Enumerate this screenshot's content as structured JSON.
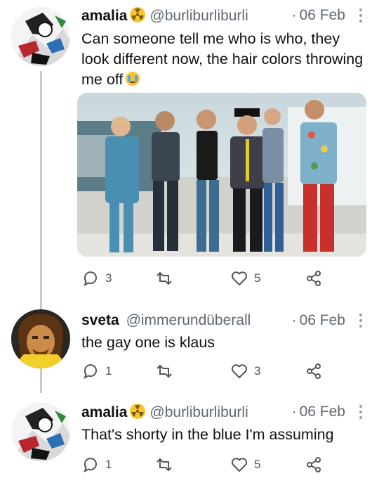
{
  "tweets": [
    {
      "user": "amalia",
      "handle": "@burliburliburli",
      "time": "06 Feb",
      "text": "Can someone tell me who is who, they look different now, the hair colors throwing me off",
      "emoji": "crying-face-emoji",
      "replies": "3",
      "retweets": "",
      "likes": "5"
    },
    {
      "user": "sveta",
      "handle": "@immerundüberall",
      "time": "06 Feb",
      "text": "the gay one is klaus",
      "replies": "1",
      "retweets": "",
      "likes": "3"
    },
    {
      "user": "amalia",
      "handle": "@burliburliburli",
      "time": "06 Feb",
      "text": "That's shorty in the blue I'm assuming",
      "replies": "1",
      "retweets": "",
      "likes": "5"
    }
  ],
  "icons": {
    "reply": "speech-bubble-icon",
    "retweet": "retweet-icon",
    "like": "heart-icon",
    "share": "share-icon",
    "more": "vertical-dots-icon",
    "badge": "radioactive-badge-icon"
  },
  "colors": {
    "name": "#111111",
    "handle": "#61686f",
    "thread_line": "#c7ccd1",
    "badge": "#f6c431"
  }
}
